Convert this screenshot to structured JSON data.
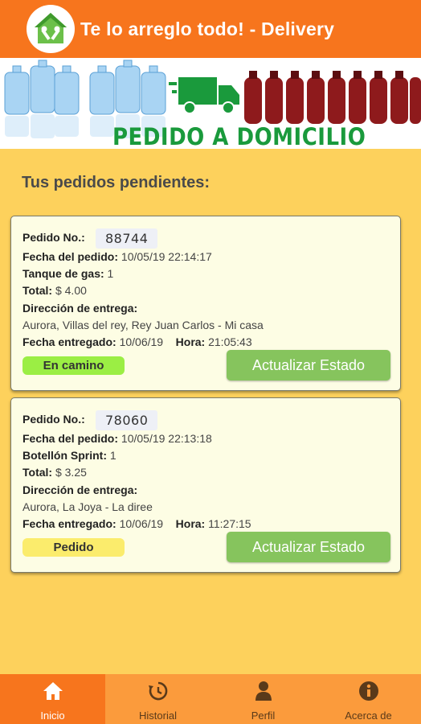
{
  "app": {
    "title": "Te lo arreglo todo! - Delivery"
  },
  "banner": {
    "text": "PEDIDO A DOMICILIO"
  },
  "section": {
    "title": "Tus pedidos pendientes:"
  },
  "labels": {
    "order_no": "Pedido No.:",
    "order_date": "Fecha del pedido:",
    "total": "Total:",
    "address": "Dirección de entrega:",
    "delivered_date": "Fecha entregado:",
    "hour": "Hora:",
    "update_button": "Actualizar Estado"
  },
  "orders": [
    {
      "number": "88744",
      "date": "10/05/19 22:14:17",
      "product_label": "Tanque de gas:",
      "product_qty": "1",
      "total": "$ 4.00",
      "address": "Aurora, Villas del rey, Rey Juan Carlos - Mi casa",
      "delivered_date": "10/06/19",
      "hour": "21:05:43",
      "status": "En camino",
      "status_color": "#9bee44"
    },
    {
      "number": "78060",
      "date": "10/05/19 22:13:18",
      "product_label": "Botellón Sprint:",
      "product_qty": "1",
      "total": "$ 3.25",
      "address": "Aurora, La Joya - La diree",
      "delivered_date": "10/06/19",
      "hour": "11:27:15",
      "status": "Pedido",
      "status_color": "#fbec6c"
    }
  ],
  "nav": {
    "items": [
      {
        "label": "Inicio",
        "icon": "home-icon",
        "active": true
      },
      {
        "label": "Historial",
        "icon": "history-icon",
        "active": false
      },
      {
        "label": "Perfil",
        "icon": "person-icon",
        "active": false
      },
      {
        "label": "Acerca de",
        "icon": "info-icon",
        "active": false
      }
    ]
  },
  "colors": {
    "appbar": "#f7751d",
    "background": "#fdd15c",
    "button": "#86c45d",
    "nav": "#fb9b3c",
    "banner_text": "#1a9a3c"
  }
}
